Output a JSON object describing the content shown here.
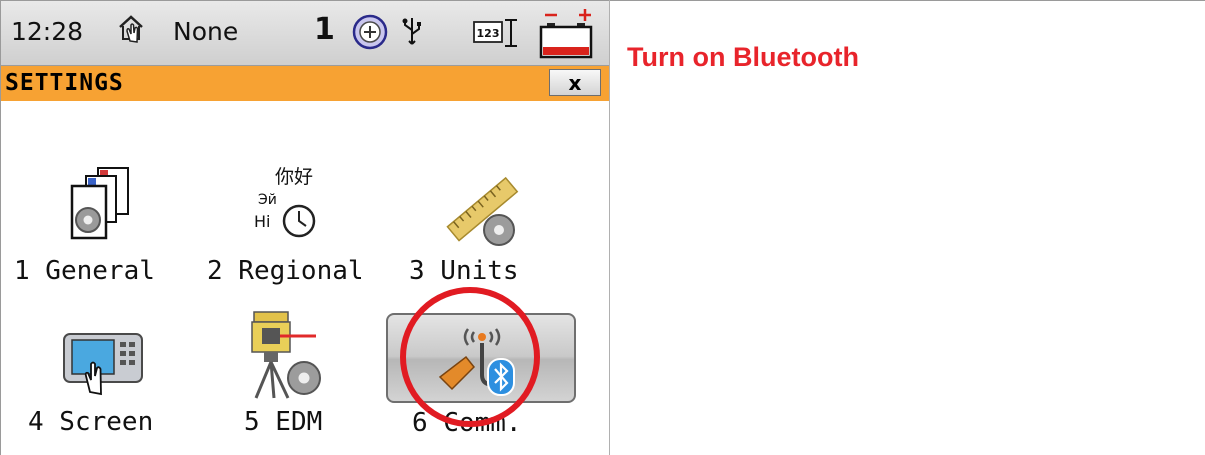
{
  "status_bar": {
    "time": "12:28",
    "profile": "None",
    "satellites": "1",
    "input_mode": "123",
    "icons": [
      "home-hand-icon",
      "gnss-position-icon",
      "usb-icon",
      "keyboard-mode-icon",
      "battery-icon"
    ]
  },
  "title_bar": {
    "title": "SETTINGS",
    "close_label": "x"
  },
  "instruction": "Turn on Bluetooth",
  "menu": {
    "items": [
      {
        "label": "1 General",
        "icon": "general-settings-icon"
      },
      {
        "label": "2 Regional",
        "icon": "regional-settings-icon",
        "icon_text": [
          "你好",
          "Эй",
          "Hi"
        ]
      },
      {
        "label": "3 Units",
        "icon": "units-settings-icon"
      },
      {
        "label": "4 Screen",
        "icon": "screen-settings-icon"
      },
      {
        "label": "5 EDM",
        "icon": "edm-settings-icon"
      },
      {
        "label": "6 Comm.",
        "icon": "bluetooth-comm-icon",
        "selected": true
      }
    ]
  },
  "colors": {
    "title_bar": "#f7a233",
    "instruction": "#e8242b",
    "annotation_circle": "#e11b22",
    "battery_red": "#d9231c"
  }
}
